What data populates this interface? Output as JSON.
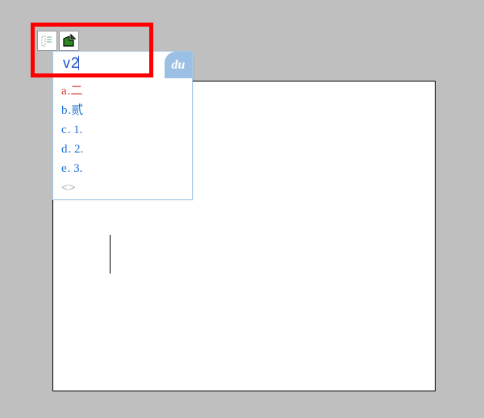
{
  "iconBar": {
    "icon1_name": "document-icon",
    "icon2_name": "merge-shape-icon"
  },
  "ime": {
    "input_value": "v2",
    "logo_text": "du",
    "candidates": [
      {
        "key": "a",
        "text": "二",
        "selected": true
      },
      {
        "key": "b",
        "text": "贰",
        "selected": false
      },
      {
        "key": "c",
        "text": "1.",
        "selected": false
      },
      {
        "key": "d",
        "text": "2.",
        "selected": false
      },
      {
        "key": "e",
        "text": "3.",
        "selected": false
      }
    ],
    "pager_prev": "<",
    "pager_next": ">"
  }
}
